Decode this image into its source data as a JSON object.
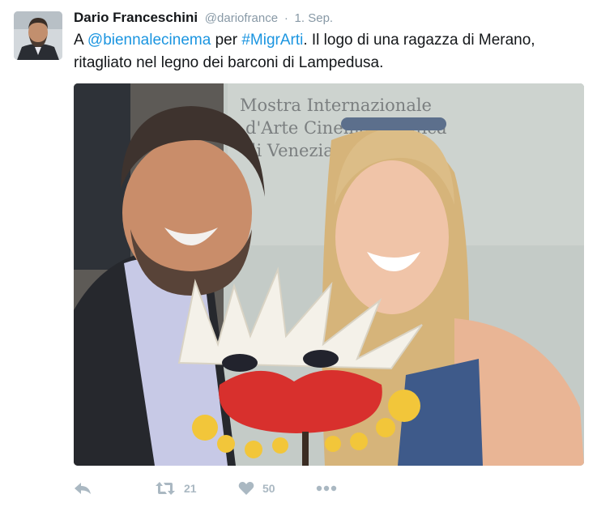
{
  "author": {
    "name": "Dario Franceschini",
    "handle": "@dariofrance",
    "separator": "·",
    "time": "1. Sep."
  },
  "tweet": {
    "part1": "A ",
    "mention": "@biennalecinema",
    "part2": " per ",
    "hashtag": "#MigrArti",
    "part3": ". Il logo di una ragazza di Merano, ritagliato nel legno dei barconi di Lampedusa."
  },
  "media": {
    "sign_line1": "Mostra Internazionale",
    "sign_line2": "d'Arte Cinematografica",
    "sign_line3": "di Venezia"
  },
  "actions": {
    "reply_icon": "reply-icon",
    "retweet_icon": "retweet-icon",
    "retweet_count": "21",
    "like_icon": "heart-icon",
    "like_count": "50",
    "more_icon": "more-icon"
  },
  "colors": {
    "link": "#1b95e0",
    "muted": "#8899a6",
    "action": "#aab8c2"
  }
}
